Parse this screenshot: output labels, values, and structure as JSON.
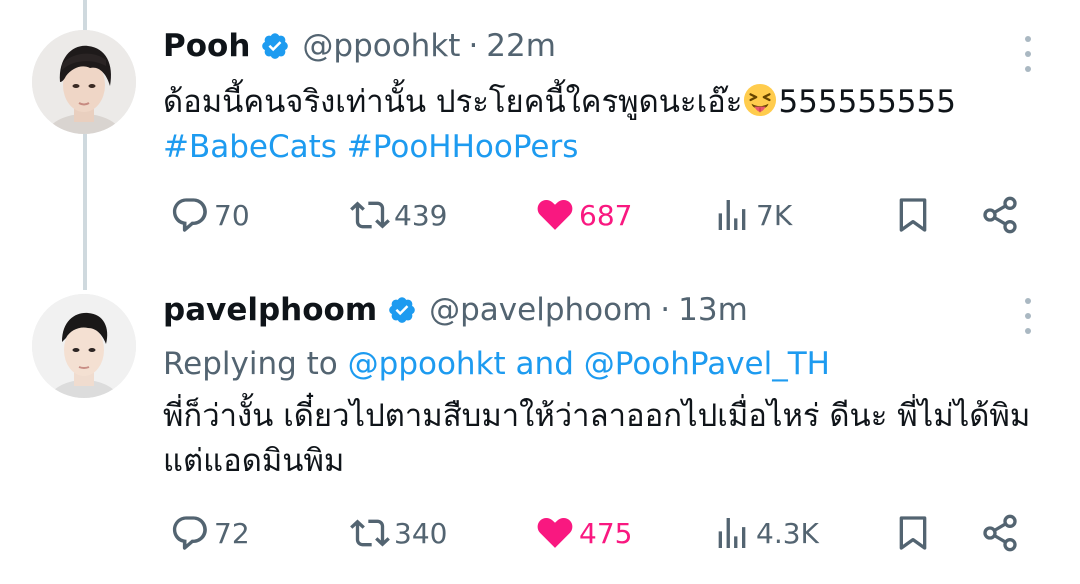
{
  "colors": {
    "accent": "#1d9bf0",
    "like": "#f91880",
    "secondary_text": "#536471",
    "primary_text": "#0f1419"
  },
  "tweets": [
    {
      "author_name": "Pooh",
      "handle": "@ppoohkt",
      "separator": "·",
      "time": "22m",
      "text_line1": "ด้อมนี้คนจริงเท่านั้น ประโยคนี้ใครพูดนะเอ๊ะ",
      "emoji": "squinting-face-with-tongue",
      "text_line1_suffix": "555555555",
      "hashtag1": "#BabeCats",
      "hashtag2": "#PooHHooPers",
      "replies": "70",
      "retweets": "439",
      "likes": "687",
      "views": "7K"
    },
    {
      "author_name": "pavelphoom",
      "handle": "@pavelphoom",
      "separator": "·",
      "time": "13m",
      "replying_prefix": "Replying to",
      "replying_to_1": "@ppoohkt",
      "replying_and": "and",
      "replying_to_2": "@PoohPavel_TH",
      "text_line1": "พี่ก็ว่างั้น เดี๋ยวไปตามสืบมาให้ว่าลาออกไปเมื่อไหร่ ดีนะ พี่ไม่ได้พิม",
      "text_line2": "แต่แอดมินพิม",
      "replies": "72",
      "retweets": "340",
      "likes": "475",
      "views": "4.3K"
    }
  ]
}
